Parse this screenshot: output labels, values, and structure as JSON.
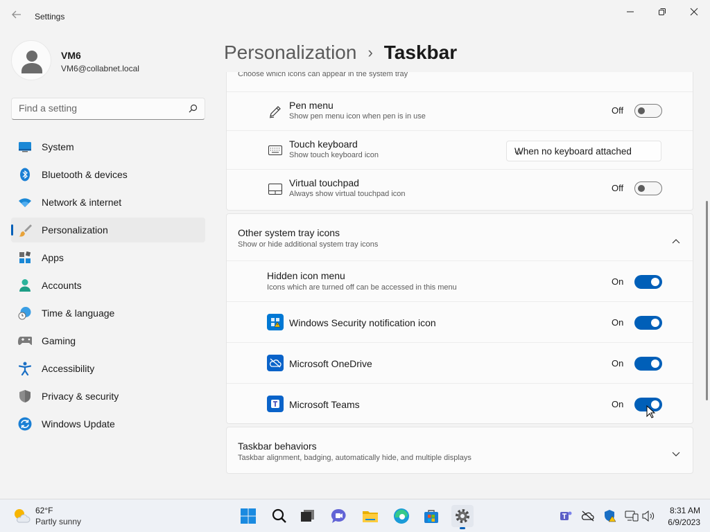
{
  "window": {
    "title": "Settings",
    "back_icon": "back-arrow-icon",
    "controls": [
      "minimize-icon",
      "restore-icon",
      "close-icon"
    ]
  },
  "profile": {
    "name": "VM6",
    "email": "VM6@collabnet.local"
  },
  "search": {
    "placeholder": "Find a setting"
  },
  "nav": {
    "items": [
      {
        "label": "System",
        "icon": "system-icon"
      },
      {
        "label": "Bluetooth & devices",
        "icon": "bluetooth-icon"
      },
      {
        "label": "Network & internet",
        "icon": "wifi-icon"
      },
      {
        "label": "Personalization",
        "icon": "brush-icon",
        "active": true
      },
      {
        "label": "Apps",
        "icon": "apps-icon"
      },
      {
        "label": "Accounts",
        "icon": "accounts-icon"
      },
      {
        "label": "Time & language",
        "icon": "globe-clock-icon"
      },
      {
        "label": "Gaming",
        "icon": "controller-icon"
      },
      {
        "label": "Accessibility",
        "icon": "accessibility-icon"
      },
      {
        "label": "Privacy & security",
        "icon": "shield-icon"
      },
      {
        "label": "Windows Update",
        "icon": "update-icon"
      }
    ]
  },
  "header": {
    "parent": "Personalization",
    "separator": "›",
    "current": "Taskbar"
  },
  "corner_icons": {
    "partial_sub": "Choose which icons can appear in the system tray",
    "rows": [
      {
        "title": "Pen menu",
        "sub": "Show pen menu icon when pen is in use",
        "state": "Off",
        "icon": "pen-icon"
      },
      {
        "title": "Touch keyboard",
        "sub": "Show touch keyboard icon",
        "value": "When no keyboard attached",
        "icon": "keyboard-icon"
      },
      {
        "title": "Virtual touchpad",
        "sub": "Always show virtual touchpad icon",
        "state": "Off",
        "icon": "touchpad-icon"
      }
    ]
  },
  "other_tray": {
    "title": "Other system tray icons",
    "sub": "Show or hide additional system tray icons",
    "hidden_menu": {
      "title": "Hidden icon menu",
      "sub": "Icons which are turned off can be accessed in this menu",
      "state": "On"
    },
    "apps": [
      {
        "title": "Windows Security notification icon",
        "state": "On",
        "icon": "windows-security-icon",
        "color": "#0078d4"
      },
      {
        "title": "Microsoft OneDrive",
        "state": "On",
        "icon": "onedrive-icon",
        "color": "#0a63c9"
      },
      {
        "title": "Microsoft Teams",
        "state": "On",
        "icon": "teams-icon",
        "color": "#0a63c9"
      }
    ]
  },
  "behaviors": {
    "title": "Taskbar behaviors",
    "sub": "Taskbar alignment, badging, automatically hide, and multiple displays"
  },
  "taskbar": {
    "weather": {
      "temp": "62°F",
      "condition": "Partly sunny"
    },
    "apps": [
      "start-icon",
      "search-icon",
      "task-view-icon",
      "chat-icon",
      "file-explorer-icon",
      "edge-icon",
      "store-icon",
      "settings-icon"
    ],
    "tray": [
      "teams-tray-icon",
      "onedrive-offline-icon",
      "security-warning-icon",
      "network-icon",
      "volume-icon"
    ],
    "time": "8:31 AM",
    "date": "6/9/2023"
  },
  "colors": {
    "accent": "#005fb8",
    "background": "#f3f3f3",
    "card": "#fbfbfb"
  }
}
